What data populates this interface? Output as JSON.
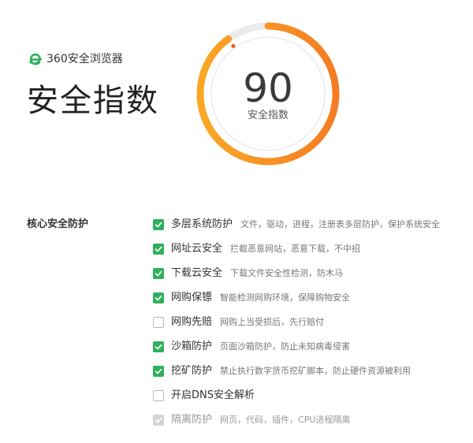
{
  "brand": {
    "logo_icon": "360-browser-e-logo-icon",
    "name": "360安全浏览器",
    "accent_color": "#2fb15b"
  },
  "page_title": "安全指数",
  "gauge": {
    "score": 90,
    "max": 100,
    "score_text": "90",
    "label": "安全指数",
    "colors": {
      "progress_start": "#f9a825",
      "progress_end": "#f57c24",
      "track": "#ebebeb",
      "marker": "#ee5a1c"
    }
  },
  "core_protection": {
    "section_label": "核心安全防护",
    "items": [
      {
        "name": "多层系统防护",
        "description": "文件，驱动，进程，注册表多层防护，保护系统安全",
        "state": "checked"
      },
      {
        "name": "网址云安全",
        "description": "拦截恶意网站，恶意下载，不中招",
        "state": "checked"
      },
      {
        "name": "下载云安全",
        "description": "下载文件安全性检测，防木马",
        "state": "checked"
      },
      {
        "name": "网购保镖",
        "description": "智能检测网购环境，保障购物安全",
        "state": "checked"
      },
      {
        "name": "网购先赔",
        "description": "网购上当受损后，先行赔付",
        "state": "unchecked"
      },
      {
        "name": "沙箱防护",
        "description": "页面沙箱防护，防止未知病毒侵害",
        "state": "checked"
      },
      {
        "name": "挖矿防护",
        "description": "禁止执行数字货币挖矿脚本，防止硬件资源被利用",
        "state": "checked"
      },
      {
        "name": "开启DNS安全解析",
        "description": "",
        "state": "unchecked"
      },
      {
        "name": "隔离防护",
        "description": "网页，代码，插件，CPU进程隔离",
        "state": "disabled"
      }
    ]
  }
}
